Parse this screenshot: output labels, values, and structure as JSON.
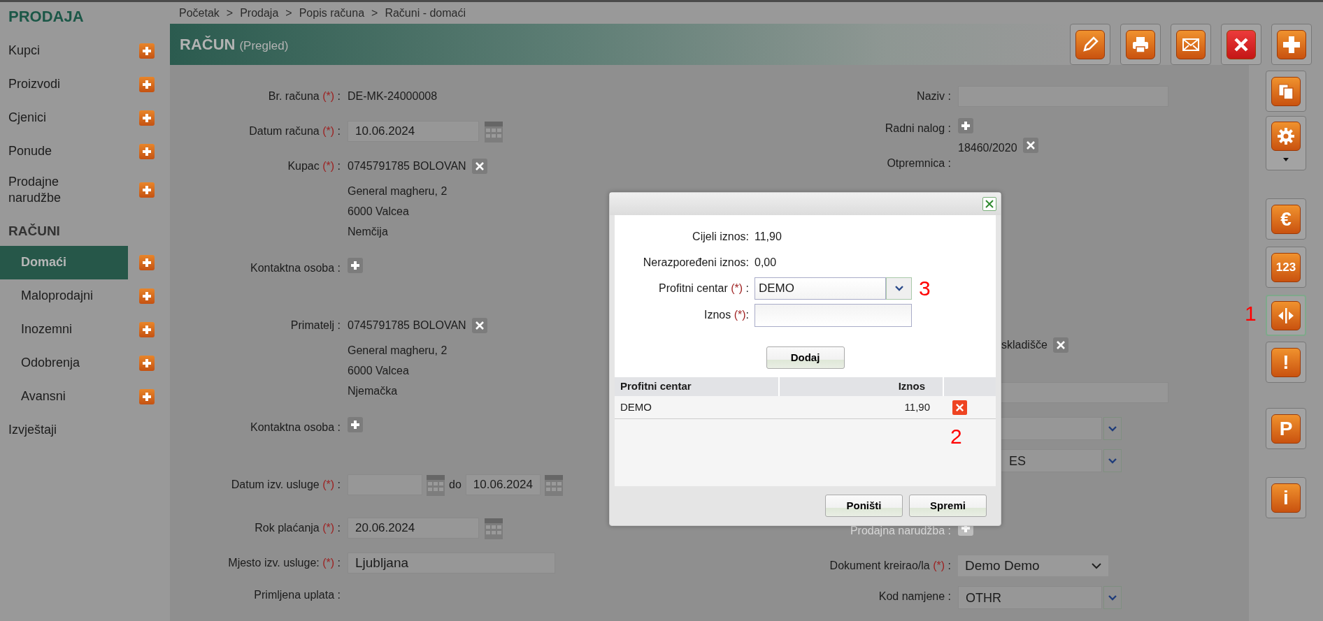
{
  "sidebar": {
    "title": "PRODAJA",
    "items": [
      {
        "kind": "item",
        "label": "Kupci",
        "add": true,
        "selected": false
      },
      {
        "kind": "item",
        "label": "Proizvodi",
        "add": true,
        "selected": false
      },
      {
        "kind": "item",
        "label": "Cjenici",
        "add": true,
        "selected": false
      },
      {
        "kind": "item",
        "label": "Ponude",
        "add": true,
        "selected": false
      },
      {
        "kind": "item",
        "label": "Prodajne narudžbe",
        "add": true,
        "selected": false
      },
      {
        "kind": "heading",
        "label": "RAČUNI"
      },
      {
        "kind": "subitem",
        "label": "Domaći",
        "add": true,
        "selected": true
      },
      {
        "kind": "subitem",
        "label": "Maloprodajni",
        "add": true,
        "selected": false
      },
      {
        "kind": "subitem",
        "label": "Inozemni",
        "add": true,
        "selected": false
      },
      {
        "kind": "subitem",
        "label": "Odobrenja",
        "add": true,
        "selected": false
      },
      {
        "kind": "subitem",
        "label": "Avansni",
        "add": true,
        "selected": false
      },
      {
        "kind": "item",
        "label": "Izvještaji",
        "add": false,
        "selected": false
      }
    ]
  },
  "breadcrumb": [
    {
      "label": "Početak"
    },
    {
      "separator": ">",
      "label": "Prodaja"
    },
    {
      "separator": ">",
      "label": "Popis računa"
    },
    {
      "separator": ">",
      "label": "Računi - domaći"
    }
  ],
  "header": {
    "title": "RAČUN",
    "subtitle": "(Pregled)"
  },
  "toolbar": [
    {
      "kind": "edit"
    },
    {
      "kind": "print"
    },
    {
      "kind": "email"
    },
    {
      "kind": "delete"
    },
    {
      "kind": "add"
    }
  ],
  "side_tools": [
    {
      "kind": "copy",
      "highlighted": false,
      "dropdown": false
    },
    {
      "kind": "settings",
      "highlighted": false,
      "dropdown": true
    },
    {
      "kind": "glyph",
      "glyph": "€",
      "highlighted": false,
      "dropdown": false
    },
    {
      "kind": "glyph",
      "glyph": "123",
      "highlighted": false,
      "dropdown": false
    },
    {
      "kind": "split",
      "highlighted": true,
      "dropdown": false,
      "annotation": "1"
    },
    {
      "kind": "glyph",
      "glyph": "!",
      "highlighted": false,
      "dropdown": false
    },
    {
      "kind": "glyph",
      "glyph": "P",
      "highlighted": false,
      "dropdown": false
    },
    {
      "kind": "glyph",
      "glyph": "i",
      "highlighted": false,
      "dropdown": false
    }
  ],
  "form_left": [
    {
      "kind": "text",
      "label": "Br. računa",
      "required": "(*)",
      "colon": ":",
      "value": "DE-MK-24000008"
    },
    {
      "kind": "date",
      "label": "Datum računa",
      "required": "(*)",
      "colon": ":",
      "value": "10.06.2024"
    },
    {
      "kind": "party",
      "label": "Kupac",
      "required": "(*)",
      "colon": ":",
      "value": "0745791785 BOLOVAN",
      "lines": [
        "General magheru, 2",
        "6000 Valcea",
        "Nemčija"
      ]
    },
    {
      "kind": "add",
      "label": "Kontaktna osoba",
      "colon": ":"
    },
    {
      "kind": "party",
      "label": "Primatelj",
      "colon": ":",
      "value": "0745791785 BOLOVAN",
      "lines": [
        "General magheru, 2",
        "6000 Valcea",
        "Njemačka"
      ]
    },
    {
      "kind": "add",
      "label": "Kontaktna osoba",
      "colon": ":"
    },
    {
      "kind": "daterange",
      "label": "Datum izv. usluge",
      "required": "(*)",
      "colon": ":",
      "joiner": "do",
      "value_to": "10.06.2024"
    },
    {
      "kind": "date",
      "label": "Rok plaćanja",
      "required": "(*)",
      "colon": ":",
      "value": "20.06.2024"
    },
    {
      "kind": "input",
      "label": "Mjesto izv. usluge:",
      "required": "(*)",
      "colon": ":",
      "value": "Ljubljana"
    },
    {
      "kind": "text",
      "label": "Primljena uplata",
      "colon": ":"
    }
  ],
  "form_right": [
    {
      "kind": "input",
      "label": "Naziv",
      "colon": ":"
    },
    {
      "kind": "add",
      "label": "Radni nalog",
      "colon": ":"
    },
    {
      "kind": "ref",
      "label": "Otpremnica",
      "colon": ":",
      "value": "18460/2020"
    },
    {
      "kind": "partial_text",
      "value": "skladišče"
    },
    {
      "kind": "partial_input"
    },
    {
      "kind": "partial_select"
    },
    {
      "kind": "partial_select",
      "value": "ES"
    },
    {
      "kind": "faded_add",
      "label": "Prodajna narudžba",
      "colon": ":"
    },
    {
      "kind": "dropdown",
      "label": "Dokument kreirao/la",
      "required": "(*)",
      "colon": ":",
      "value": "Demo Demo"
    },
    {
      "kind": "select",
      "label": "Kod namjene",
      "colon": ":",
      "value": "OTHR"
    }
  ],
  "modal": {
    "summary": [
      {
        "label": "Cijeli iznos:",
        "value": "11,90"
      },
      {
        "label": "Nerazpoređeni iznos:",
        "value": "0,00"
      }
    ],
    "fields": [
      {
        "kind": "select",
        "label": "Profitni centar",
        "required": "(*)",
        "colon": ":",
        "value": "DEMO",
        "annotation": "3"
      },
      {
        "kind": "input",
        "label": "Iznos",
        "required": "(*)",
        "colon": ":"
      }
    ],
    "add_button": "Dodaj",
    "table": {
      "columns": [
        "Profitni centar",
        "Iznos"
      ],
      "rows": [
        {
          "cells": [
            "DEMO",
            "11,90"
          ]
        }
      ],
      "annotation": "2"
    },
    "buttons": [
      "Poništi",
      "Spremi"
    ]
  }
}
